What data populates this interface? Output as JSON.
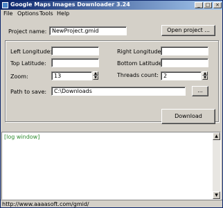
{
  "window": {
    "title": "Google Maps Images Downloader 3.24",
    "minimize": "_",
    "maximize": "□",
    "close": "×"
  },
  "menu": [
    "File",
    "Options",
    "Tools",
    "Help"
  ],
  "form": {
    "project_name_label": "Project name:",
    "project_name_value": "NewProject.gmid",
    "open_project_button": "Open project ...",
    "left_longitude_label": "Left Longitude:",
    "left_longitude_value": "",
    "right_longitude_label": "Right Longitude:",
    "right_longitude_value": "",
    "top_latitude_label": "Top Latitude:",
    "top_latitude_value": "",
    "bottom_latitude_label": "Bottom Latitude:",
    "bottom_latitude_value": "",
    "zoom_label": "Zoom:",
    "zoom_value": "13",
    "threads_label": "Threads count:",
    "threads_value": "2",
    "path_label": "Path to save:",
    "path_value": "C:\\Downloads",
    "browse_button": "...",
    "download_button": "Download"
  },
  "log": {
    "text": "[log window]"
  },
  "status": {
    "url": "http://www.aaaasoft.com/gmid/"
  },
  "icons": [
    "app-icon",
    "spin-up-icon",
    "spin-down-icon",
    "scroll-up-icon",
    "scroll-down-icon"
  ]
}
